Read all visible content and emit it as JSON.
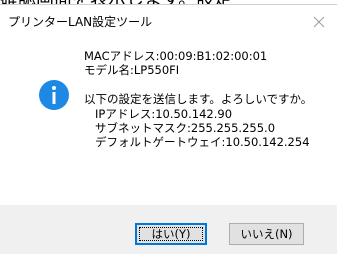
{
  "background_window": {
    "clipped_text": "確認画面を表示します。設定"
  },
  "dialog": {
    "title": "プリンターLAN設定ツール",
    "close_glyph": "✕",
    "icon": "info-icon",
    "device": {
      "mac_line": "MACアドレス:00:09:B1:02:00:01",
      "model_line": "モデル名:LP550FI"
    },
    "question": "以下の設定を送信します。よろしいですか。",
    "settings": {
      "ip_line": "IPアドレス:10.50.142.90",
      "subnet_line": "サブネットマスク:255.255.255.0",
      "gateway_line": "デフォルトゲートウェイ:10.50.142.254"
    },
    "buttons": {
      "yes_label": "はい(Y)",
      "no_label": "いいえ(N)"
    }
  },
  "colors": {
    "accent": "#0078d7",
    "footer_background": "#f0f0f0",
    "button_face": "#e1e1e1",
    "close_glyph": "#808080"
  }
}
